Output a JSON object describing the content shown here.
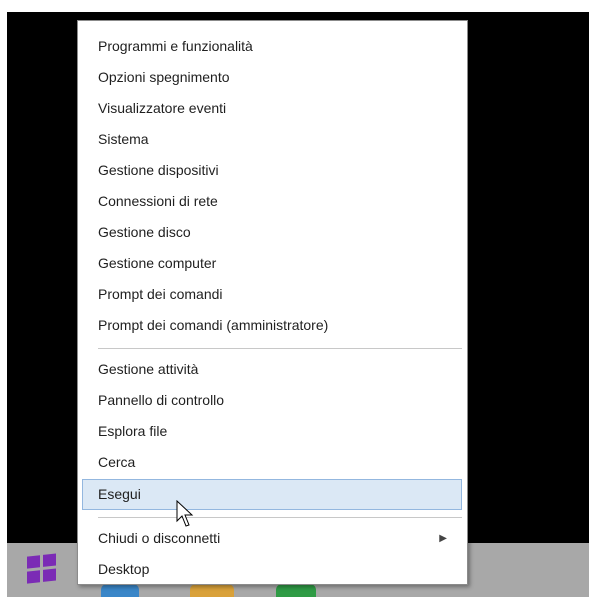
{
  "colors": {
    "desktop_background": "#000000",
    "taskbar_background": "#a8a8a8",
    "selected_item_fill": "#dbe8f5",
    "selected_item_border": "#93b7df",
    "start_logo": "#7b2bb5"
  },
  "context_menu": {
    "section_1": [
      {
        "label": "Programmi e funzionalità"
      },
      {
        "label": "Opzioni spegnimento"
      },
      {
        "label": "Visualizzatore eventi"
      },
      {
        "label": "Sistema"
      },
      {
        "label": "Gestione dispositivi"
      },
      {
        "label": "Connessioni di rete"
      },
      {
        "label": "Gestione disco"
      },
      {
        "label": "Gestione computer"
      },
      {
        "label": "Prompt dei comandi"
      },
      {
        "label": "Prompt dei comandi (amministratore)"
      }
    ],
    "section_2": [
      {
        "label": "Gestione attività"
      },
      {
        "label": "Pannello di controllo"
      },
      {
        "label": "Esplora file"
      },
      {
        "label": "Cerca"
      },
      {
        "label": "Esegui",
        "selected": true
      }
    ],
    "section_3": [
      {
        "label": "Chiudi o disconnetti",
        "has_submenu": true,
        "submenu_icon": "chevron-right-icon"
      },
      {
        "label": "Desktop"
      }
    ]
  },
  "taskbar": {
    "start_button_icon": "windows-logo-icon",
    "pinned_app_icons": [
      "app-icon-blue",
      "app-icon-yellow",
      "app-icon-green"
    ]
  }
}
